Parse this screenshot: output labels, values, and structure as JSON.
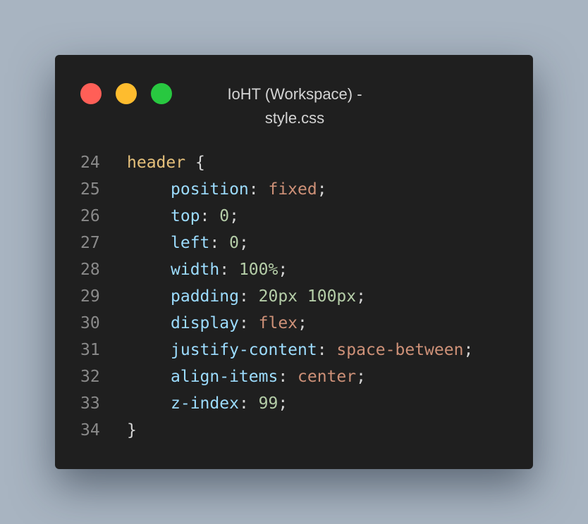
{
  "window": {
    "title_line1": "IoHT (Workspace) -",
    "title_line2": "style.css"
  },
  "colors": {
    "background": "#a8b4c1",
    "window": "#1f1f1f",
    "close_dot": "#ff5f57",
    "minimize_dot": "#febc2e",
    "maximize_dot": "#28c840",
    "selector": "#e5c07b",
    "property": "#9cdcfe",
    "keyword_value": "#ce9178",
    "numeric_value": "#b5cea8",
    "line_number": "#8a8a8a"
  },
  "code": {
    "lines": [
      {
        "n": "24",
        "selector": "header",
        "open": " {"
      },
      {
        "n": "25",
        "prop": "position",
        "value": "fixed",
        "kind": "kw"
      },
      {
        "n": "26",
        "prop": "top",
        "value": "0",
        "kind": "num"
      },
      {
        "n": "27",
        "prop": "left",
        "value": "0",
        "kind": "num"
      },
      {
        "n": "28",
        "prop": "width",
        "value": "100%",
        "kind": "num"
      },
      {
        "n": "29",
        "prop": "padding",
        "value": "20px 100px",
        "kind": "num"
      },
      {
        "n": "30",
        "prop": "display",
        "value": "flex",
        "kind": "kw"
      },
      {
        "n": "31",
        "prop": "justify-content",
        "value": "space-between",
        "kind": "kw"
      },
      {
        "n": "32",
        "prop": "align-items",
        "value": "center",
        "kind": "kw"
      },
      {
        "n": "33",
        "prop": "z-index",
        "value": "99",
        "kind": "num"
      },
      {
        "n": "34",
        "close": "}"
      }
    ]
  }
}
